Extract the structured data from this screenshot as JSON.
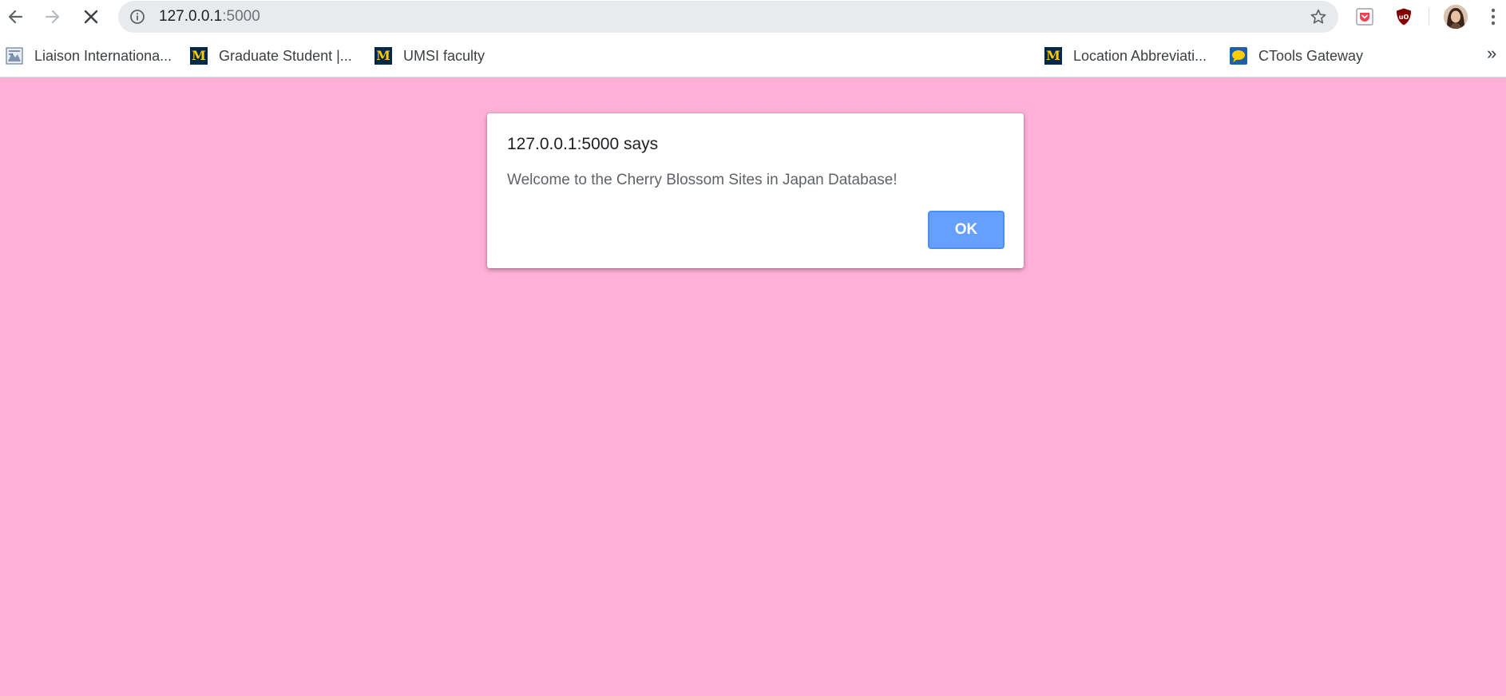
{
  "browser": {
    "address_bar": {
      "url_host": "127.0.0.1",
      "url_port": ":5000"
    },
    "icons": {
      "back": "arrow-left-icon",
      "forward": "arrow-right-icon",
      "stop": "close-icon",
      "site_info": "info-icon",
      "bookmark": "star-icon",
      "menu": "kebab-menu-icon"
    },
    "extensions": [
      {
        "name": "pocket-icon",
        "color": "#ef4056"
      },
      {
        "name": "ublock-origin-icon",
        "color": "#800000"
      }
    ]
  },
  "bookmarks": [
    {
      "label": "Liaison Internationa...",
      "icon": "liaison-favicon"
    },
    {
      "label": "Graduate Student |...",
      "icon": "michigan-m-icon"
    },
    {
      "label": "UMSI faculty",
      "icon": "michigan-m-icon"
    },
    {
      "label": "Location Abbreviati...",
      "icon": "michigan-m-icon"
    },
    {
      "label": "CTools Gateway",
      "icon": "ctools-chat-icon"
    }
  ],
  "bookmarks_overflow": "»",
  "page": {
    "background_color": "#feb0d6"
  },
  "alert": {
    "title": "127.0.0.1:5000 says",
    "message": "Welcome to the Cherry Blossom Sites in Japan Database!",
    "ok_label": "OK",
    "button_color": "#66a0ff"
  }
}
